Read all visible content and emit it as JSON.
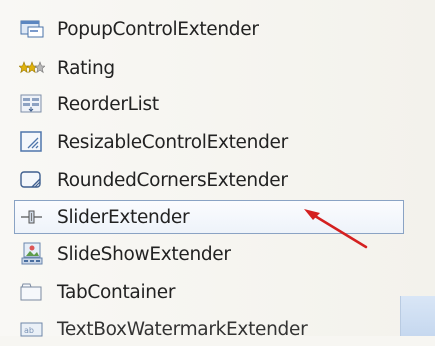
{
  "toolbox": {
    "items": [
      {
        "label": "PopupControlExtender",
        "icon": "popup-control-icon"
      },
      {
        "label": "Rating",
        "icon": "rating-stars-icon"
      },
      {
        "label": "ReorderList",
        "icon": "reorder-list-icon"
      },
      {
        "label": "ResizableControlExtender",
        "icon": "resizable-control-icon"
      },
      {
        "label": "RoundedCornersExtender",
        "icon": "rounded-corners-icon"
      },
      {
        "label": "SliderExtender",
        "icon": "slider-icon",
        "selected": true
      },
      {
        "label": "SlideShowExtender",
        "icon": "slideshow-icon"
      },
      {
        "label": "TabContainer",
        "icon": "tab-container-icon"
      },
      {
        "label": "TextBoxWatermarkExtender",
        "icon": "textbox-watermark-icon"
      }
    ]
  },
  "annotation": {
    "arrow_color": "#d42020"
  },
  "colors": {
    "selection_border": "#8aa3c4",
    "selection_fill": "#eef3fa"
  }
}
